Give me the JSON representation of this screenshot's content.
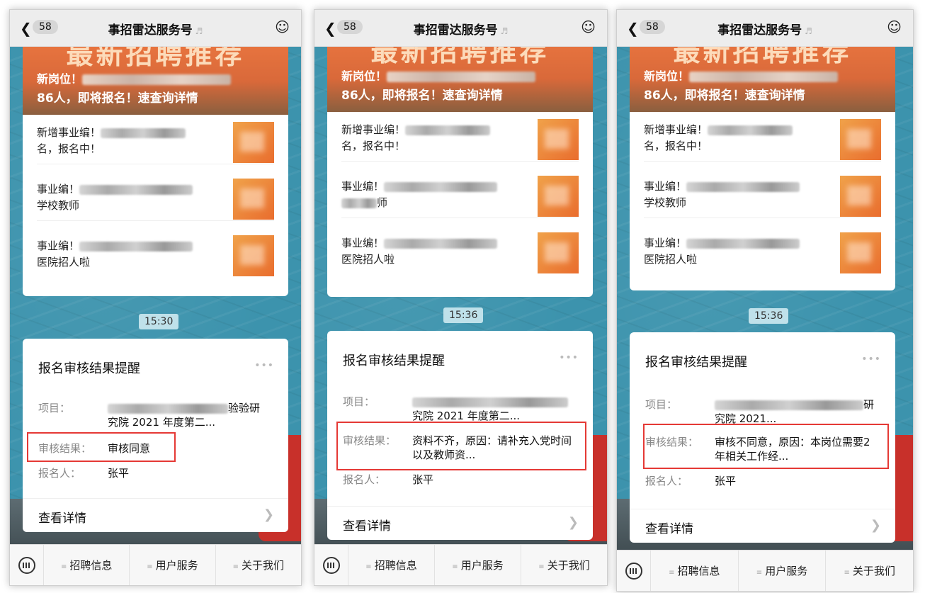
{
  "screens": [
    {
      "nav": {
        "badge": "58",
        "title": "事招雷达服务号"
      },
      "hero": {
        "big": "最新招聘推荐",
        "line1": "新岗位！",
        "line2": "86人，即将报名！速查询详情"
      },
      "articles": [
        {
          "line1": "新增事业编！",
          "line2": "名，报名中！"
        },
        {
          "line1": "事业编！",
          "line2": "学校教师"
        },
        {
          "line1": "事业编！",
          "line2": "医院招人啦"
        }
      ],
      "time": "15:30",
      "card": {
        "title": "报名审核结果提醒",
        "project_label": "项目：",
        "project_value_end": "验验研",
        "project_value_line2": "究院 2021 年度第二...",
        "result_label": "审核结果：",
        "result_value": "审核同意",
        "applicant_label": "报名人：",
        "applicant_value": "张平",
        "detail": "查看详情"
      },
      "tabs": [
        "招聘信息",
        "用户服务",
        "关于我们"
      ]
    },
    {
      "nav": {
        "badge": "58",
        "title": "事招雷达服务号"
      },
      "hero": {
        "big": "最新招聘推荐",
        "line1": "新岗位！",
        "line2": "86人，即将报名！速查询详情"
      },
      "articles": [
        {
          "line1": "新增事业编！",
          "line2": "名，报名中！"
        },
        {
          "line1": "事业编！",
          "line2": "师"
        },
        {
          "line1": "事业编！",
          "line2": "医院招人啦"
        }
      ],
      "time": "15:36",
      "card": {
        "title": "报名审核结果提醒",
        "project_label": "项目：",
        "project_value_end": "",
        "project_value_line2": "究院 2021 年度第二...",
        "result_label": "审核结果：",
        "result_value": "资料不齐，原因：请补充入党时间以及教师资...",
        "applicant_label": "报名人：",
        "applicant_value": "张平",
        "detail": "查看详情"
      },
      "tabs": [
        "招聘信息",
        "用户服务",
        "关于我们"
      ]
    },
    {
      "nav": {
        "badge": "58",
        "title": "事招雷达服务号"
      },
      "hero": {
        "big": "最新招聘推荐",
        "line1": "新岗位！",
        "line2": "86人，即将报名！速查询详情"
      },
      "articles": [
        {
          "line1": "新增事业编！",
          "line2": "名，报名中！"
        },
        {
          "line1": "事业编！",
          "line2": "学校教师"
        },
        {
          "line1": "事业编！",
          "line2": "医院招人啦"
        }
      ],
      "time": "15:36",
      "card": {
        "title": "报名审核结果提醒",
        "project_label": "项目：",
        "project_value_end": "研",
        "project_value_line2": "究院 2021...",
        "result_label": "审核结果：",
        "result_value": "审核不同意，原因：本岗位需要2年相关工作经...",
        "applicant_label": "报名人：",
        "applicant_value": "张平",
        "detail": "查看详情"
      },
      "tabs": [
        "招聘信息",
        "用户服务",
        "关于我们"
      ]
    }
  ],
  "colors": {
    "highlight": "#e53935",
    "hero": "#e9753f",
    "water": "#3c93ad"
  }
}
